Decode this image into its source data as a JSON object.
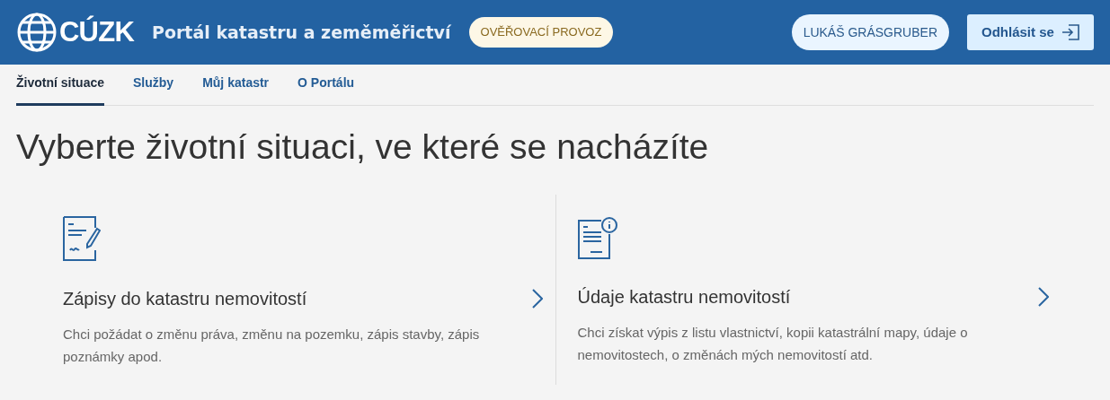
{
  "header": {
    "logo": "CÚZK",
    "title": "Portál katastru a zeměměřictví",
    "badge": "OVĚŘOVACÍ PROVOZ",
    "user": "LUKÁŠ GRÁSGRUBER",
    "logout": "Odhlásit se"
  },
  "tabs": [
    {
      "label": "Životní situace",
      "selected": true
    },
    {
      "label": "Služby",
      "selected": false
    },
    {
      "label": "Můj katastr",
      "selected": false
    },
    {
      "label": "O Portálu",
      "selected": false
    }
  ],
  "heading": "Vyberte životní situaci, ve které se nacházíte",
  "cards": [
    {
      "kind": "signing",
      "title": "Zápisy do katastru nemovitostí",
      "description": "Chci požádat o změnu práva, změnu na pozemku, zápis stavby, zápis poznámky apod."
    },
    {
      "kind": "info",
      "title": "Údaje katastru nemovitostí",
      "description": "Chci získat výpis z listu vlastnictví, kopii katastrální mapy, údaje o nemovitostech, o změnách mých nemovitostí atd."
    }
  ]
}
